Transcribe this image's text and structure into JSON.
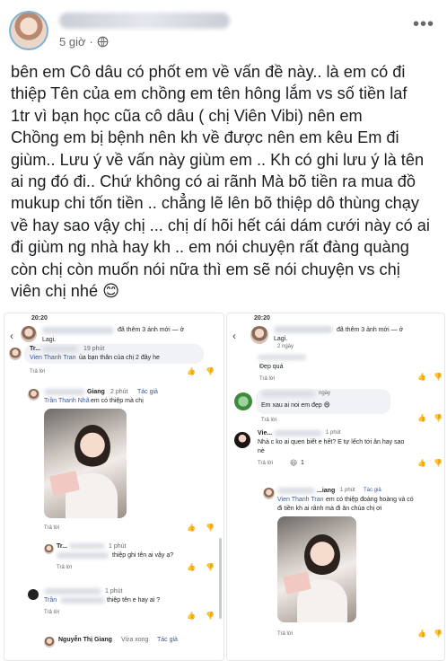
{
  "post": {
    "time": "5 giờ",
    "more": "•••",
    "lines": [
      "bên em Cô dâu có phốt em về vấn đề này.. là em có đi",
      "thiệp Tên của em chồng em tên hông lắm vs số tiền laf",
      "1tr vì bạn học cũa cô dâu ( chị Viên Vibi) nên em",
      "Chồng em bị bệnh nên kh về được nên em kêu  Em đi",
      "giùm.. Lưu ý về vấn này giùm em .. Kh có ghi lưu ý là tên",
      "ai ng đó đi.. Chứ không có ai rãnh Mà bõ tiền ra mua đồ",
      "mukup chi tốn tiền .. chẳng lẽ lên bõ thiệp dô thùng chạy",
      "về hay sao vậy chị ... chị dí hõi hết cái dám cưới này có ai",
      "đi giùm ng nhà hay kh .. em nói chuyện rất đàng quàng",
      "còn chị còn muốn nói nữa thì em sẽ nói chuyện vs chị",
      "viên chị nhé 😊"
    ]
  },
  "left": {
    "status_time": "20:20",
    "header_text": "đã thêm 3 ảnh mới — ở",
    "header_sub": "Lagi.",
    "c1_name": "Tr...",
    "c1_time": "19 phút",
    "c1_author": "Vien Thanh Tran",
    "c1_text": "ủa bạn thân của chị 2 đây he",
    "reply": "Trả lời",
    "c2_name": "Giang",
    "c2_time": "2 phút",
    "c2_edit": "Tác giả",
    "c2_author": "Trần Thanh Nhã",
    "c2_text": "em có thiệp mà chị",
    "c3_name": "Tr...",
    "c3_time": "1 phút",
    "c3_text": "thiệp ghi tên ai vậy ạ?",
    "c4_time": "1 phút",
    "c4_author": "Trần",
    "c4_text": "thiệp tên e hay ai ?",
    "c5_name": "Nguyễn Thị Giang",
    "c5_time": "Vừa xong",
    "c5_edit": "Tác giả"
  },
  "right": {
    "status_time": "20:20",
    "header_text": "đã thêm 3 ảnh mới — ở",
    "header_sub": "Lagi.",
    "header_time": "2 ngày",
    "c1_text": "Đẹp quá",
    "reply": "Trả lời",
    "c2_time": "ngày",
    "c2_text": "Em xau ai noi em đẹp 😄",
    "c3_name": "Vie...",
    "c3_time": "1 phút",
    "c3_text_1": "Nhà c ko ai quen biết e hết? E tự lếch tới ăn hay sao",
    "c3_text_2": "nè",
    "c3_reactions": "1",
    "c4_name": "...iang",
    "c4_time": "1 phút",
    "c4_edit": "Tác giả",
    "c4_author": "Vien Thanh Tran",
    "c4_text_1": "em có thiệp đoàng hoàng và có",
    "c4_text_2": "đi tiền kh ai rãnh mà đi ăn chùa chị ơi"
  }
}
